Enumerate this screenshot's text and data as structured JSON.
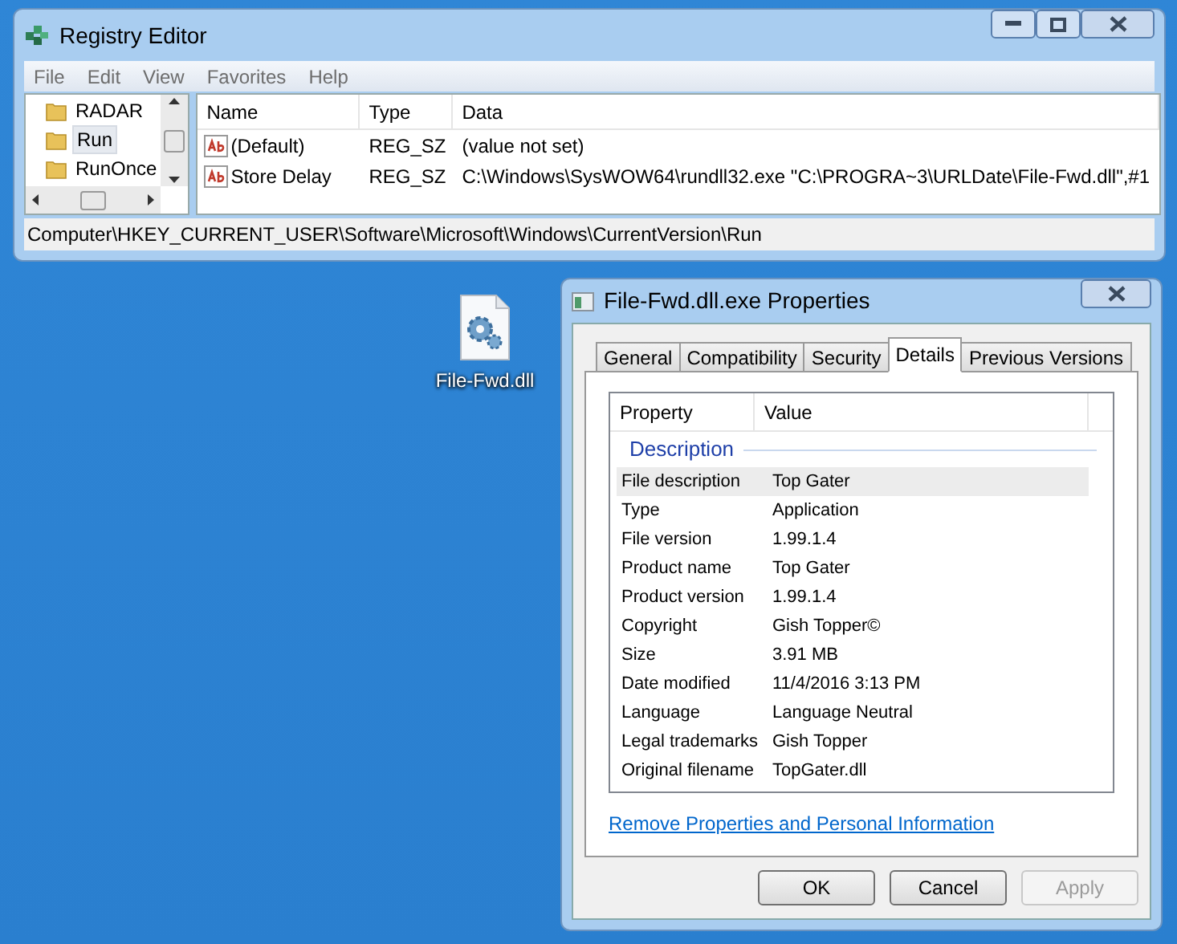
{
  "registry_editor": {
    "title": "Registry Editor",
    "menu": [
      "File",
      "Edit",
      "View",
      "Favorites",
      "Help"
    ],
    "tree": [
      {
        "label": "RADAR",
        "selected": false
      },
      {
        "label": "Run",
        "selected": true
      },
      {
        "label": "RunOnce",
        "selected": false
      }
    ],
    "columns": [
      "Name",
      "Type",
      "Data"
    ],
    "rows": [
      {
        "name": "(Default)",
        "type": "REG_SZ",
        "data": "(value not set)"
      },
      {
        "name": "Store Delay",
        "type": "REG_SZ",
        "data": "C:\\Windows\\SysWOW64\\rundll32.exe \"C:\\PROGRA~3\\URLDate\\File-Fwd.dll\",#1"
      }
    ],
    "status_bar": "Computer\\HKEY_CURRENT_USER\\Software\\Microsoft\\Windows\\CurrentVersion\\Run"
  },
  "desktop_icon": {
    "label": "File-Fwd.dll"
  },
  "properties": {
    "title": "File-Fwd.dll.exe Properties",
    "tabs": [
      {
        "label": "General",
        "selected": false
      },
      {
        "label": "Compatibility",
        "selected": false
      },
      {
        "label": "Security",
        "selected": false
      },
      {
        "label": "Details",
        "selected": true
      },
      {
        "label": "Previous Versions",
        "selected": false
      }
    ],
    "columns": [
      "Property",
      "Value"
    ],
    "group": "Description",
    "rows": [
      {
        "property": "File description",
        "value": "Top Gater",
        "selected": true
      },
      {
        "property": "Type",
        "value": "Application",
        "selected": false
      },
      {
        "property": "File version",
        "value": "1.99.1.4",
        "selected": false
      },
      {
        "property": "Product name",
        "value": "Top Gater",
        "selected": false
      },
      {
        "property": "Product version",
        "value": "1.99.1.4",
        "selected": false
      },
      {
        "property": "Copyright",
        "value": "Gish Topper©",
        "selected": false
      },
      {
        "property": "Size",
        "value": "3.91 MB",
        "selected": false
      },
      {
        "property": "Date modified",
        "value": "11/4/2016 3:13 PM",
        "selected": false
      },
      {
        "property": "Language",
        "value": "Language Neutral",
        "selected": false
      },
      {
        "property": "Legal trademarks",
        "value": "Gish Topper",
        "selected": false
      },
      {
        "property": "Original filename",
        "value": "TopGater.dll",
        "selected": false
      }
    ],
    "link": "Remove Properties and Personal Information",
    "buttons": [
      {
        "label": "OK",
        "disabled": false
      },
      {
        "label": "Cancel",
        "disabled": false
      },
      {
        "label": "Apply",
        "disabled": true
      }
    ]
  }
}
